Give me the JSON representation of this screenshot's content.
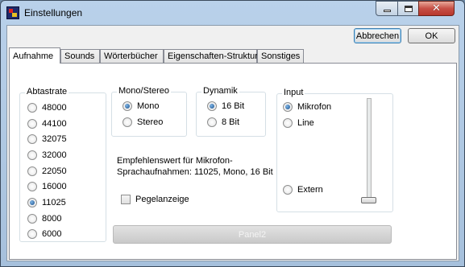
{
  "window": {
    "title": "Einstellungen",
    "icons": {
      "app": "app-icon",
      "minimize": "minimize-icon",
      "maximize": "maximize-icon",
      "close": "close-icon"
    }
  },
  "toolbar": {
    "cancel_label": "Abbrechen",
    "ok_label": "OK"
  },
  "tabs": [
    {
      "label": "Aufnahme",
      "active": true
    },
    {
      "label": "Sounds",
      "active": false
    },
    {
      "label": "Wörterbücher",
      "active": false
    },
    {
      "label": "Eigenschaften-Struktur",
      "active": false
    },
    {
      "label": "Sonstiges",
      "active": false
    }
  ],
  "sampling": {
    "label": "Abtastrate",
    "selected": "11025",
    "options": [
      "48000",
      "44100",
      "32075",
      "32000",
      "22050",
      "16000",
      "11025",
      "8000",
      "6000"
    ]
  },
  "mono_stereo": {
    "label": "Mono/Stereo",
    "selected": "Mono",
    "options": [
      "Mono",
      "Stereo"
    ]
  },
  "dynamics": {
    "label": "Dynamik",
    "selected": "16 Bit",
    "options": [
      "16 Bit",
      "8 Bit"
    ]
  },
  "input": {
    "label": "Input",
    "selected": "Mikrofon",
    "options": [
      "Mikrofon",
      "Line",
      "Extern"
    ],
    "level": 0.0
  },
  "recommendation": {
    "line1": "Empfehlenswert für Mikrofon-",
    "line2": "Sprachaufnahmen: 11025, Mono, 16 Bit"
  },
  "level_meter": {
    "label": "Pegelanzeige",
    "checked": false
  },
  "panel": {
    "label": "Panel2"
  },
  "colors": {
    "title_bar": "#b9d1ea",
    "close_button": "#c75046",
    "radio_selected": "#1a4f8a"
  }
}
